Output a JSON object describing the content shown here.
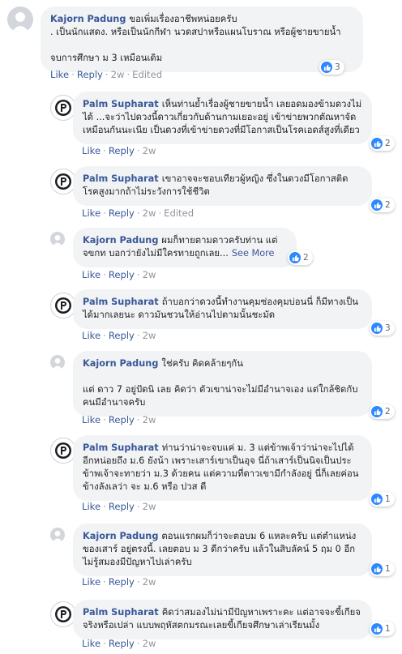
{
  "ui": {
    "like_label": "Like",
    "reply_label": "Reply",
    "edited_label": "Edited"
  },
  "colors": {
    "link": "#385898",
    "bubble": "#f2f3f5",
    "like_blue": "#2d88ff",
    "meta": "#90949c"
  },
  "comments": [
    {
      "author": "Kajorn Padung",
      "avatar": "gray-default-avatar",
      "text": "ขอเพิ่มเรื่องอาชีพหน่อยครับ\n. เป็นนักแสดง. หรือเป็นนักกีฬา นวดสปาหรือแผนโบราณ หรือผู้ชายขายน้ำ\n\nจบการศึกษา ม 3 เหมือนเดิม",
      "time": "2w",
      "edited": true,
      "reactions": "3",
      "see_more": ""
    },
    {
      "author": "Palm Supharat",
      "avatar": "palm-p-avatar",
      "text": "เห็นท่านย้ำเรื่องผู้ชายขายน้ำ เลยอดมองข้ามดวงไม่ได้ ...จะว่าไปดวงนี้ดาวเกี่ยวกับด้านกามเยอะอยู่ เข้าข่ายพวกตัณหาจัด เหมือนกันนะเนีย เป็นดวงที่เข้าข่ายดวงที่มีโอกาสเป็นโรคเอดส์สูงที่เดียว",
      "time": "2w",
      "edited": false,
      "reactions": "2",
      "see_more": ""
    },
    {
      "author": "Palm Supharat",
      "avatar": "palm-p-avatar",
      "text": "เขาอาจจะชอบเทียวผู้หญิง ซึ่งในดวงมีโอกาสติดโรคสูงมากถ้าไม่ระวังการใช้ชีวิต",
      "time": "2w",
      "edited": true,
      "reactions": "2",
      "see_more": ""
    },
    {
      "author": "Kajorn Padung",
      "avatar": "gray-default-avatar",
      "text": "ผมก็ทายตามดาวครับท่าน แต่ จขกท บอกว่ายังไม่มีใครทายถูกเลย...",
      "time": "2w",
      "edited": false,
      "reactions": "2",
      "see_more": "See More"
    },
    {
      "author": "Palm Supharat",
      "avatar": "palm-p-avatar",
      "text": "ถ้าบอกว่าดวงนี้ทำงานคุมซ่องคุมบ่อนนี่ ก็มีทางเป็นได้มากเลยนะ ดาวมันชวนให้อ่านไปตามนั้นชะมัด",
      "time": "2w",
      "edited": false,
      "reactions": "3",
      "see_more": ""
    },
    {
      "author": "Kajorn Padung",
      "avatar": "gray-default-avatar",
      "text": "ใช่ครับ คิดคล้ายๆกัน\n\nแต่ ดาว 7 อยู่ปัตนิ เลย คิดว่า ตัวเขาน่าจะไม่มีอำนาจเอง แต่ใกล้ชิดกับคนมีอำนาจครับ",
      "time": "2w",
      "edited": false,
      "reactions": "2",
      "see_more": ""
    },
    {
      "author": "Palm Supharat",
      "avatar": "palm-p-avatar",
      "text": "ท่านว่าน่าจะจบแค่ ม. 3 แต่ข้าพเจ้าว่าน่าจะไปได้อีกหน่อยถึง ม.6 ยังน้า เพราะเสาร์เขาเป็นอุจ นี่ถ้าเสาร์เป็นนิจเป็นประ ข้าพเจ้าจะทายว่า ม.3 ด้วยคน แต่ความที่ดาวเขามีกำลังอยู่ นี่ก็เลยค่อนข้างลังเลว่า จะ ม.6 หรือ ปวส ดี",
      "time": "2w",
      "edited": false,
      "reactions": "1",
      "see_more": ""
    },
    {
      "author": "Kajorn Padung",
      "avatar": "gray-default-avatar",
      "text": "ตอนแรกผมก็ว่าจะตอบม 6 แหละครับ แต่ตำแหน่งของเสาร์ อยู่ตรงนี้. เลยตอบ ม 3 ดีกว่าครับ แล้วในสิบลัคน์ 5 ฤม 0 อีก ไม่รู้สมองมีปัญหาไปเล่าครับ",
      "time": "2w",
      "edited": false,
      "reactions": "1",
      "see_more": ""
    },
    {
      "author": "Palm Supharat",
      "avatar": "palm-p-avatar",
      "text": "คิดว่าสมองไม่น่ามีปัญหาเพราะคะ แต่อาจจะขี้เกียจจริงหรือเปล่า แบบพฤหัสตกมรณะเลยขี้เกียจศึกษาเล่าเรียนมั้ง",
      "time": "2w",
      "edited": false,
      "reactions": "1",
      "see_more": ""
    }
  ]
}
